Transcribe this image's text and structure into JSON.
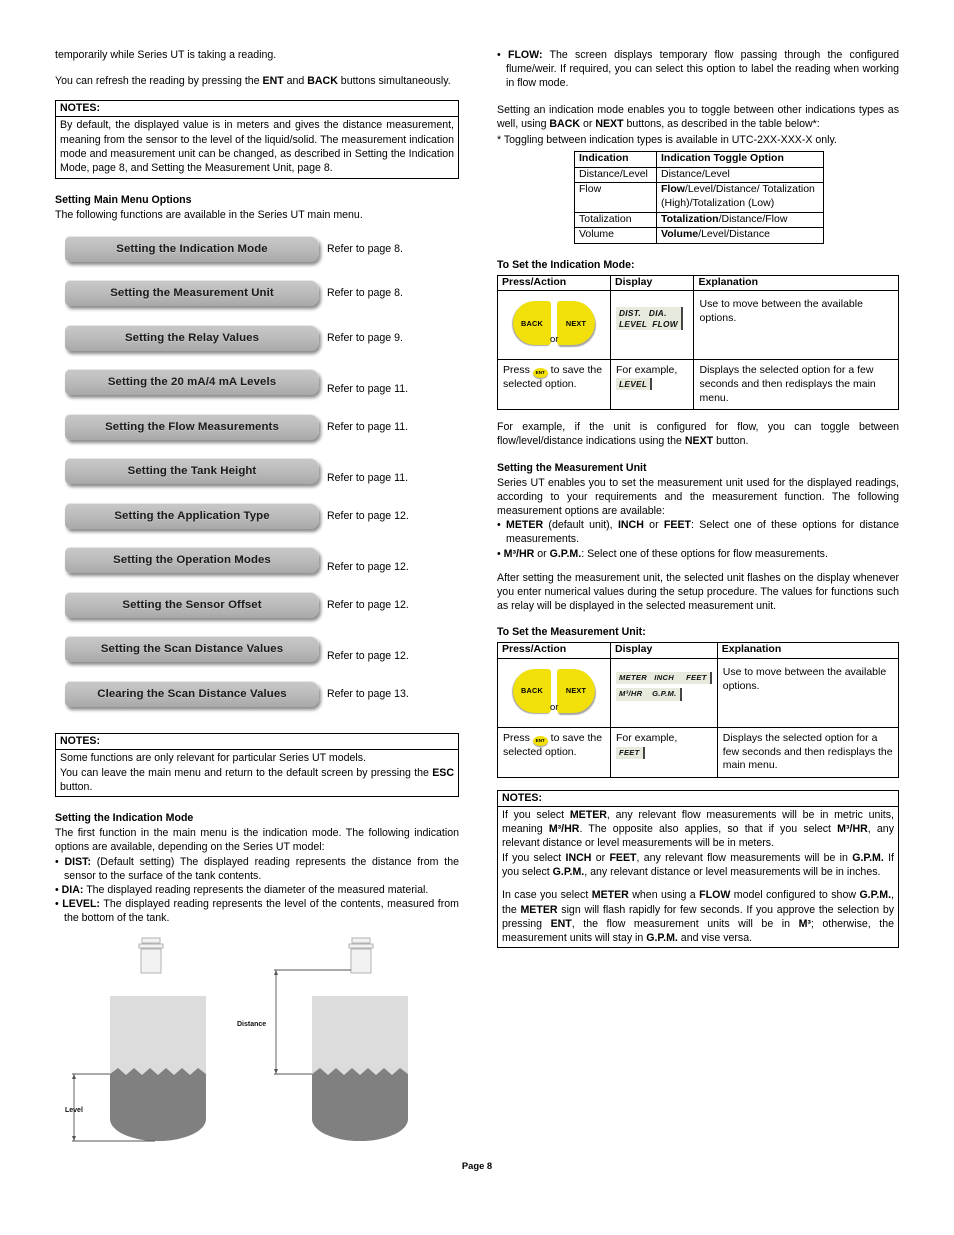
{
  "page": {
    "footer": "Page 8"
  },
  "left": {
    "para_top": "temporarily while Series UT is taking a reading.",
    "para_refresh_1": "You can refresh the reading by pressing the ",
    "para_refresh_ent": "ENT",
    "para_refresh_2": " and ",
    "para_refresh_back": "BACK",
    "para_refresh_3": " buttons simultaneously.",
    "notes1": {
      "title": "NOTES:",
      "body": "By default, the displayed value is in meters and gives the distance measurement, meaning from the sensor to the level of the liquid/solid. The measurement indication mode and measurement unit can be changed, as described in Setting the Indication Mode, page 8, and Setting the Measurement Unit, page 8."
    },
    "main_menu_heading": "Setting Main Menu Options",
    "main_menu_intro": "The following functions are available in the Series UT main menu.",
    "menu_items": [
      {
        "label": "Setting the Indication Mode",
        "ref": "Refer to page 8."
      },
      {
        "label": "Setting the Measurement Unit",
        "ref": "Refer to page 8."
      },
      {
        "label": "Setting the Relay Values",
        "ref": "Refer to page 9."
      },
      {
        "label": "Setting the 20 mA/4 mA Levels",
        "ref": "Refer to page 11."
      },
      {
        "label": "Setting the Flow Measurements",
        "ref": "Refer to page 11."
      },
      {
        "label": "Setting the Tank Height",
        "ref": "Refer to page 11."
      },
      {
        "label": "Setting the Application Type",
        "ref": "Refer to page 12."
      },
      {
        "label": "Setting the Operation Modes",
        "ref": "Refer to page 12."
      },
      {
        "label": "Setting the Sensor Offset",
        "ref": "Refer to page 12."
      },
      {
        "label": "Setting the Scan Distance Values",
        "ref": "Refer to page 12."
      },
      {
        "label": "Clearing the Scan Distance Values",
        "ref": "Refer to page 13."
      }
    ],
    "notes2": {
      "title": "NOTES:",
      "line1": "Some functions are only relevant for particular Series UT models.",
      "line2_a": "You can leave the main menu and return to the default screen by pressing the ",
      "line2_esc": "ESC",
      "line2_b": " button."
    },
    "indication_heading": "Setting the Indication Mode",
    "indication_intro": "The first function in the main menu is the indication mode. The following indication options are available, depending on the Series UT model:",
    "bullets": [
      {
        "term": "DIST:",
        "text": " (Default setting) The displayed reading represents the distance from the sensor to the surface of the tank contents."
      },
      {
        "term": "DIA:",
        "text": " The displayed reading represents the diameter of the measured material."
      },
      {
        "term": "LEVEL:",
        "text": " The displayed reading represents the level of the contents, measured from the bottom of the tank."
      }
    ],
    "diagram": {
      "label_level": "Level",
      "label_distance": "Distance"
    }
  },
  "right": {
    "flow_bullet_term": "FLOW:",
    "flow_bullet_text": " The screen displays temporary flow passing through the configured flume/weir. If required, you can select this option to label the reading when working in flow mode.",
    "toggle_para_1": "Setting an indication mode enables you to toggle between other indications types as well, using ",
    "toggle_back": "BACK",
    "toggle_para_2": " or ",
    "toggle_next": "NEXT",
    "toggle_para_3": " buttons, as described in the table below*:",
    "toggle_footnote": "* Toggling between indication types is available in UTC-2XX-XXX-X only.",
    "indication_table": {
      "headers": [
        "Indication",
        "Indication Toggle Option"
      ],
      "rows": [
        {
          "indication": "Distance/Level",
          "bold": "",
          "rest": "Distance/Level"
        },
        {
          "indication": "Flow",
          "bold": "Flow",
          "rest": "/Level/Distance/ Totalization (High)/Totalization (Low)"
        },
        {
          "indication": "Totalization",
          "bold": "Totalization",
          "rest": "/Distance/Flow"
        },
        {
          "indication": "Volume",
          "bold": "Volume",
          "rest": "/Level/Distance"
        }
      ]
    },
    "set_indication_heading": "To Set the Indication Mode:",
    "pa_headers": [
      "Press/Action",
      "Display",
      "Explanation"
    ],
    "indication_proc": {
      "row1": {
        "btn_back": "BACK",
        "btn_next": "NEXT",
        "or": "or",
        "lcd_line1": "DIST.   DIA.",
        "lcd_line2": "LEVEL  FLOW",
        "explanation": "Use to move between the available options."
      },
      "row2": {
        "action_a": "Press ",
        "action_btn": "ENT",
        "action_b": " to save the selected option.",
        "display_label": "For example,",
        "lcd": "LEVEL",
        "explanation": "Displays the selected option for a few seconds and then redisplays the main menu."
      }
    },
    "example_para_1": "For example, if the unit is configured for flow, you can toggle between flow/level/distance indications using the ",
    "example_next": "NEXT",
    "example_para_2": " button.",
    "unit_heading": "Setting the Measurement Unit",
    "unit_intro": "Series UT enables you to set the measurement unit used for the displayed readings, according to your requirements and the measurement function. The following measurement options are available:",
    "unit_bullets": [
      {
        "b1": "METER",
        "t1": " (default unit), ",
        "b2": "INCH",
        "t2": " or ",
        "b3": "FEET",
        "t3": ": Select one of these options for distance measurements."
      },
      {
        "b1": "M³/HR",
        "t1": " or ",
        "b2": "G.P.M.",
        "t2": ": Select one of these options for flow measurements.",
        "b3": "",
        "t3": ""
      }
    ],
    "unit_after": "After setting the measurement unit, the selected unit flashes on the display whenever you enter numerical values during the setup procedure. The values for functions such as relay will be displayed in the selected measurement unit.",
    "set_unit_heading": "To Set the Measurement Unit:",
    "unit_proc": {
      "row1": {
        "btn_back": "BACK",
        "btn_next": "NEXT",
        "or": "or",
        "lcd_line1": "METER   INCH     FEET",
        "lcd_line2": "M³/HR    G.P.M.",
        "explanation": "Use to move between the available options."
      },
      "row2": {
        "action_a": "Press ",
        "action_btn": "ENT",
        "action_b": " to save the selected option.",
        "display_label": "For example,",
        "lcd": "FEET",
        "explanation": "Displays the selected option for a few seconds and then redisplays the main menu."
      }
    },
    "notes3": {
      "title": "NOTES:",
      "p1_a": "If you select ",
      "p1_b1": "METER",
      "p1_b": ", any relevant flow measurements will be in metric units, meaning ",
      "p1_b2": "M³/HR",
      "p1_c": ". The opposite also applies, so that if you select ",
      "p1_b3": "M³/HR",
      "p1_d": ", any relevant distance or level measurements will be in meters.",
      "p2_a": "If you select ",
      "p2_b1": "INCH",
      "p2_b": " or ",
      "p2_b2": "FEET",
      "p2_c": ", any relevant flow measurements will be in ",
      "p2_b3": "G.P.M.",
      "p2_d": " If you select ",
      "p2_b4": "G.P.M.",
      "p2_e": ", any relevant distance or level measurements will be in inches.",
      "p3_a": "In case you select ",
      "p3_b1": "METER",
      "p3_b": " when using a ",
      "p3_b2": "FLOW",
      "p3_c": " model configured to show ",
      "p3_b3": "G.P.M.",
      "p3_d": ", the ",
      "p3_b4": "METER",
      "p3_e": " sign will flash rapidly for few seconds. If you approve the selection by pressing ",
      "p3_b5": "ENT",
      "p3_f": ", the flow measurement units will be in ",
      "p3_b6": "M³",
      "p3_g": "; otherwise, the measurement units will stay in ",
      "p3_b7": "G.P.M.",
      "p3_h": " and vise versa."
    }
  },
  "colors": {
    "button_yellow": "#F2E00A",
    "lcd_bg": "#e7ebdd",
    "tank_empty": "#dcdcdc",
    "tank_fill": "#808080",
    "menu_button": "#bdbdbd"
  }
}
